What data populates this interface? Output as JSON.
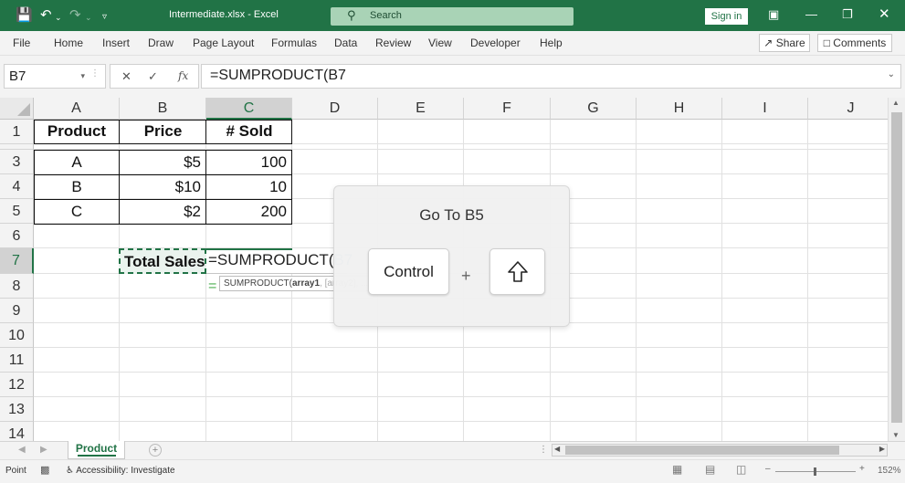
{
  "titlebar": {
    "title": "Intermediate.xlsx  -  Excel",
    "search_placeholder": "Search",
    "signin_label": "Sign in",
    "icons": [
      "save-icon",
      "undo-icon",
      "redo-icon",
      "customize-icon",
      "ribbon-display-icon",
      "minimize-icon",
      "restore-icon",
      "close-icon"
    ]
  },
  "menu": {
    "items": [
      "File",
      "Home",
      "Insert",
      "Draw",
      "Page Layout",
      "Formulas",
      "Data",
      "Review",
      "View",
      "Developer",
      "Help"
    ],
    "share_label": "Share",
    "comments_label": "Comments"
  },
  "formula_bar": {
    "name_box": "B7",
    "formula": "=SUMPRODUCT(B7"
  },
  "grid": {
    "columns": [
      "A",
      "B",
      "C",
      "D",
      "E",
      "F",
      "G",
      "H",
      "I",
      "J"
    ],
    "selected_column": "C",
    "rows": [
      "1",
      "3",
      "4",
      "5",
      "6",
      "7",
      "8",
      "9",
      "10",
      "11",
      "12",
      "13",
      "14"
    ],
    "selected_row": "7",
    "header_row": [
      "Product",
      "Price",
      "# Sold"
    ],
    "data_rows": [
      [
        "A",
        "$5",
        "100"
      ],
      [
        "B",
        "$10",
        "10"
      ],
      [
        "C",
        "$2",
        "200"
      ]
    ],
    "b7_value": "Total Sales",
    "c7_edit_prefix": "=SUMPRODUCT(",
    "c7_edit_ref": "B7",
    "tooltip_func": "SUMPRODUCT(",
    "tooltip_arg1": "array1",
    "tooltip_rest": ", [array2], ...)"
  },
  "overlay": {
    "title": "Go To B5",
    "key1": "Control",
    "plus": "+",
    "key2_icon": "shift-arrow-icon"
  },
  "sheets": {
    "tabs": [
      "Product"
    ],
    "active": "Product"
  },
  "status": {
    "mode": "Point",
    "accessibility": "Accessibility: Investigate",
    "zoom": "152%"
  }
}
